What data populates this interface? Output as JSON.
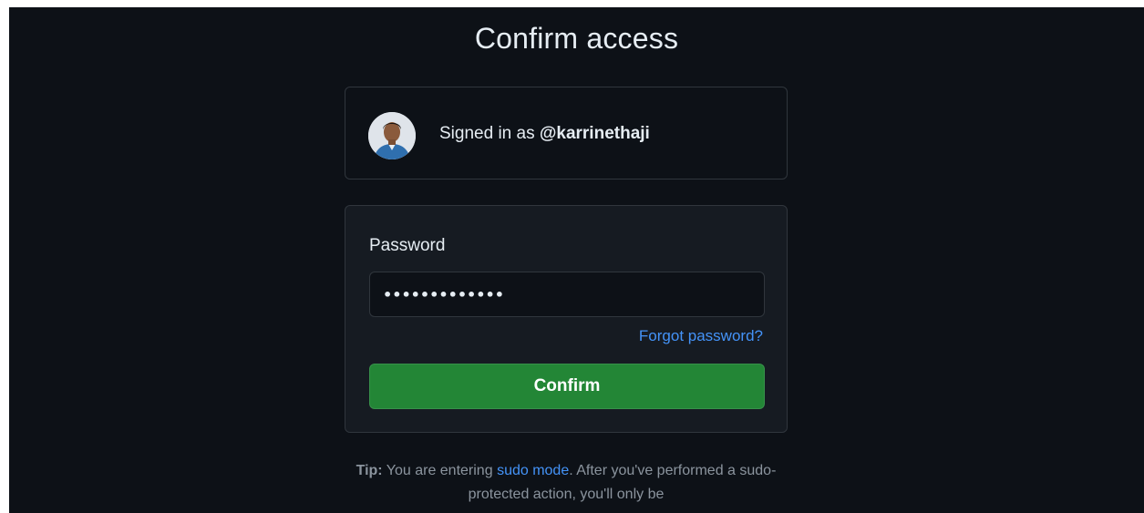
{
  "page": {
    "title": "Confirm access"
  },
  "account": {
    "signed_in_prefix": "Signed in as",
    "username": "@karrinethaji",
    "avatar_icon": "user-avatar"
  },
  "form": {
    "password_label": "Password",
    "password_value": "•••••••••••••",
    "forgot_link": "Forgot password?",
    "confirm_button": "Confirm"
  },
  "tip": {
    "label": "Tip:",
    "text_before_link": "You are entering",
    "link": "sudo mode",
    "text_after_link": ". After you've performed a sudo-protected action, you'll only be"
  },
  "colors": {
    "background": "#0d1117",
    "card": "#161b22",
    "border": "#30363d",
    "text": "#e6edf3",
    "muted": "#8b949e",
    "link": "#4493f8",
    "primary": "#238636"
  }
}
